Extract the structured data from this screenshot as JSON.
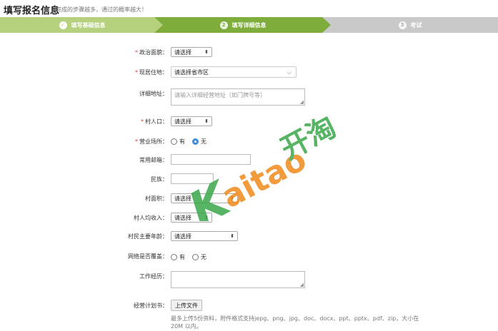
{
  "header": {
    "title": "填写报名信息",
    "subtitle": "完成的步骤越多，通过的概率越大！"
  },
  "steps": [
    {
      "label": "填写基础信息",
      "icon": "check-icon",
      "num": ""
    },
    {
      "label": "填写详细信息",
      "icon": "number-icon",
      "num": "2"
    },
    {
      "label": "考试",
      "icon": "number-icon",
      "num": "3"
    }
  ],
  "form": {
    "political": {
      "label": "政治面貌：",
      "value": "请选择"
    },
    "residence": {
      "label": "现居住地：",
      "value": "请选择省市区"
    },
    "address": {
      "label": "详细地址：",
      "placeholder": "请输入详细经营地址（如门牌号等）"
    },
    "village_pop": {
      "label": "村人口：",
      "value": "请选择"
    },
    "business_place": {
      "label": "营业场所：",
      "option_yes": "有",
      "option_no": "无",
      "selected": "无"
    },
    "email": {
      "label": "常用邮箱："
    },
    "ethnicity": {
      "label": "民族："
    },
    "village_area": {
      "label": "村面积：",
      "value": "请选择"
    },
    "per_capita": {
      "label": "村人均收入：",
      "value": "请选择"
    },
    "main_age": {
      "label": "村民主要年龄：",
      "value": "请选择"
    },
    "network": {
      "label": "网络是否覆盖：",
      "option_yes": "有",
      "option_no": "无"
    },
    "work_exp": {
      "label": "工作经历："
    },
    "business_plan": {
      "label": "经营计划书：",
      "button": "上传文件",
      "hint": "最多上传5份资料，附件格式支持jepg、png、jpg、doc、docx、ppt、pptx、pdf、zip，大小在 20M 以内。"
    }
  },
  "watermark": {
    "latin": "Kaitao",
    "cjk": "开淘"
  },
  "colors": {
    "step_done": "#b5d17e",
    "step_active": "#7ead3c",
    "step_todo": "#c9c9c9",
    "required": "#e03b3b",
    "radio_checked": "#3b8fe0",
    "wm_green": "#3aa84a",
    "wm_orange": "#f08a1c"
  }
}
